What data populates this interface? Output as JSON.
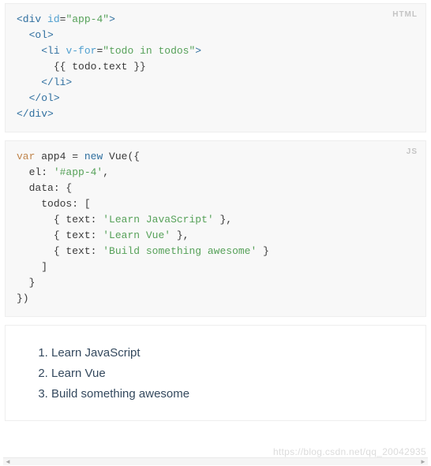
{
  "blocks": {
    "html": {
      "label": "HTML",
      "lines": {
        "l0": {
          "open_div": "<div",
          "sp": " ",
          "attr_id": "id",
          "eq": "=",
          "val_id": "\"app-4\"",
          "close": ">"
        },
        "l1": {
          "open_ol": "<ol>"
        },
        "l2": {
          "open_li": "<li",
          "sp": " ",
          "attr_vfor": "v-for",
          "eq": "=",
          "val_vfor": "\"todo in todos\"",
          "close": ">"
        },
        "l3": {
          "text": "{{ todo.text }}"
        },
        "l4": {
          "close_li": "</li>"
        },
        "l5": {
          "close_ol": "</ol>"
        },
        "l6": {
          "close_div": "</div>"
        }
      }
    },
    "js": {
      "label": "JS",
      "lines": {
        "l0": {
          "kw_var": "var",
          "id_app4": " app4 ",
          "eq": "=",
          "sp": " ",
          "kw_new": "new",
          "id_vue": " Vue({"
        },
        "l1": {
          "key_el": "el",
          "colon": ": ",
          "val_el": "'#app-4'",
          "comma": ","
        },
        "l2": {
          "key_data": "data",
          "colon": ": {",
          "empty": ""
        },
        "l3": {
          "key_todos": "todos",
          "colon": ": [",
          "empty": ""
        },
        "l4": {
          "open": "{ ",
          "key_text": "text",
          "colon": ": ",
          "val": "'Learn JavaScript'",
          "close": " },"
        },
        "l5": {
          "open": "{ ",
          "key_text": "text",
          "colon": ": ",
          "val": "'Learn Vue'",
          "close": " },"
        },
        "l6": {
          "open": "{ ",
          "key_text": "text",
          "colon": ": ",
          "val": "'Build something awesome'",
          "close": " }"
        },
        "l7": {
          "text": "]"
        },
        "l8": {
          "text": "}"
        },
        "l9": {
          "text": "})"
        }
      }
    }
  },
  "output": {
    "items": {
      "i0": "Learn JavaScript",
      "i1": "Learn Vue",
      "i2": "Build something awesome"
    }
  },
  "watermark": "https://blog.csdn.net/qq_20042935"
}
